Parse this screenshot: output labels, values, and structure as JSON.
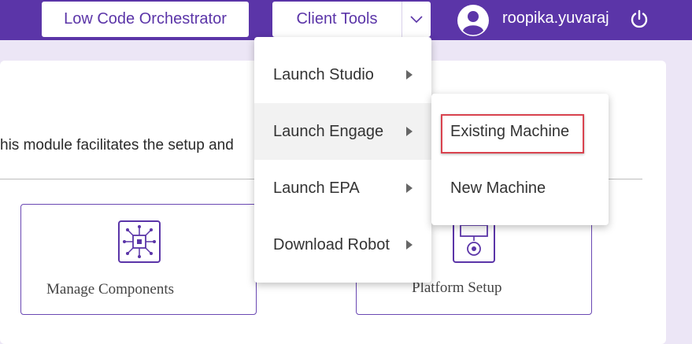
{
  "header": {
    "low_code_label": "Low Code Orchestrator",
    "client_tools_label": "Client Tools",
    "username": "roopika.yuvaraj",
    "icons": {
      "avatar": "user-avatar-icon",
      "power": "power-icon",
      "chevron": "chevron-down-icon"
    }
  },
  "main": {
    "description": "his module facilitates the setup and",
    "tiles": [
      {
        "label": "Manage Components",
        "icon": "chip-icon"
      },
      {
        "label": "Platform Setup",
        "icon": "monitor-gear-icon"
      }
    ]
  },
  "menu": {
    "items": [
      {
        "label": "Launch Studio"
      },
      {
        "label": "Launch Engage"
      },
      {
        "label": "Launch EPA"
      },
      {
        "label": "Download Robot"
      }
    ]
  },
  "submenu": {
    "items": [
      {
        "label": "Existing Machine"
      },
      {
        "label": "New Machine"
      }
    ]
  },
  "colors": {
    "brand": "#5b35a8",
    "highlight": "#d9434f"
  }
}
